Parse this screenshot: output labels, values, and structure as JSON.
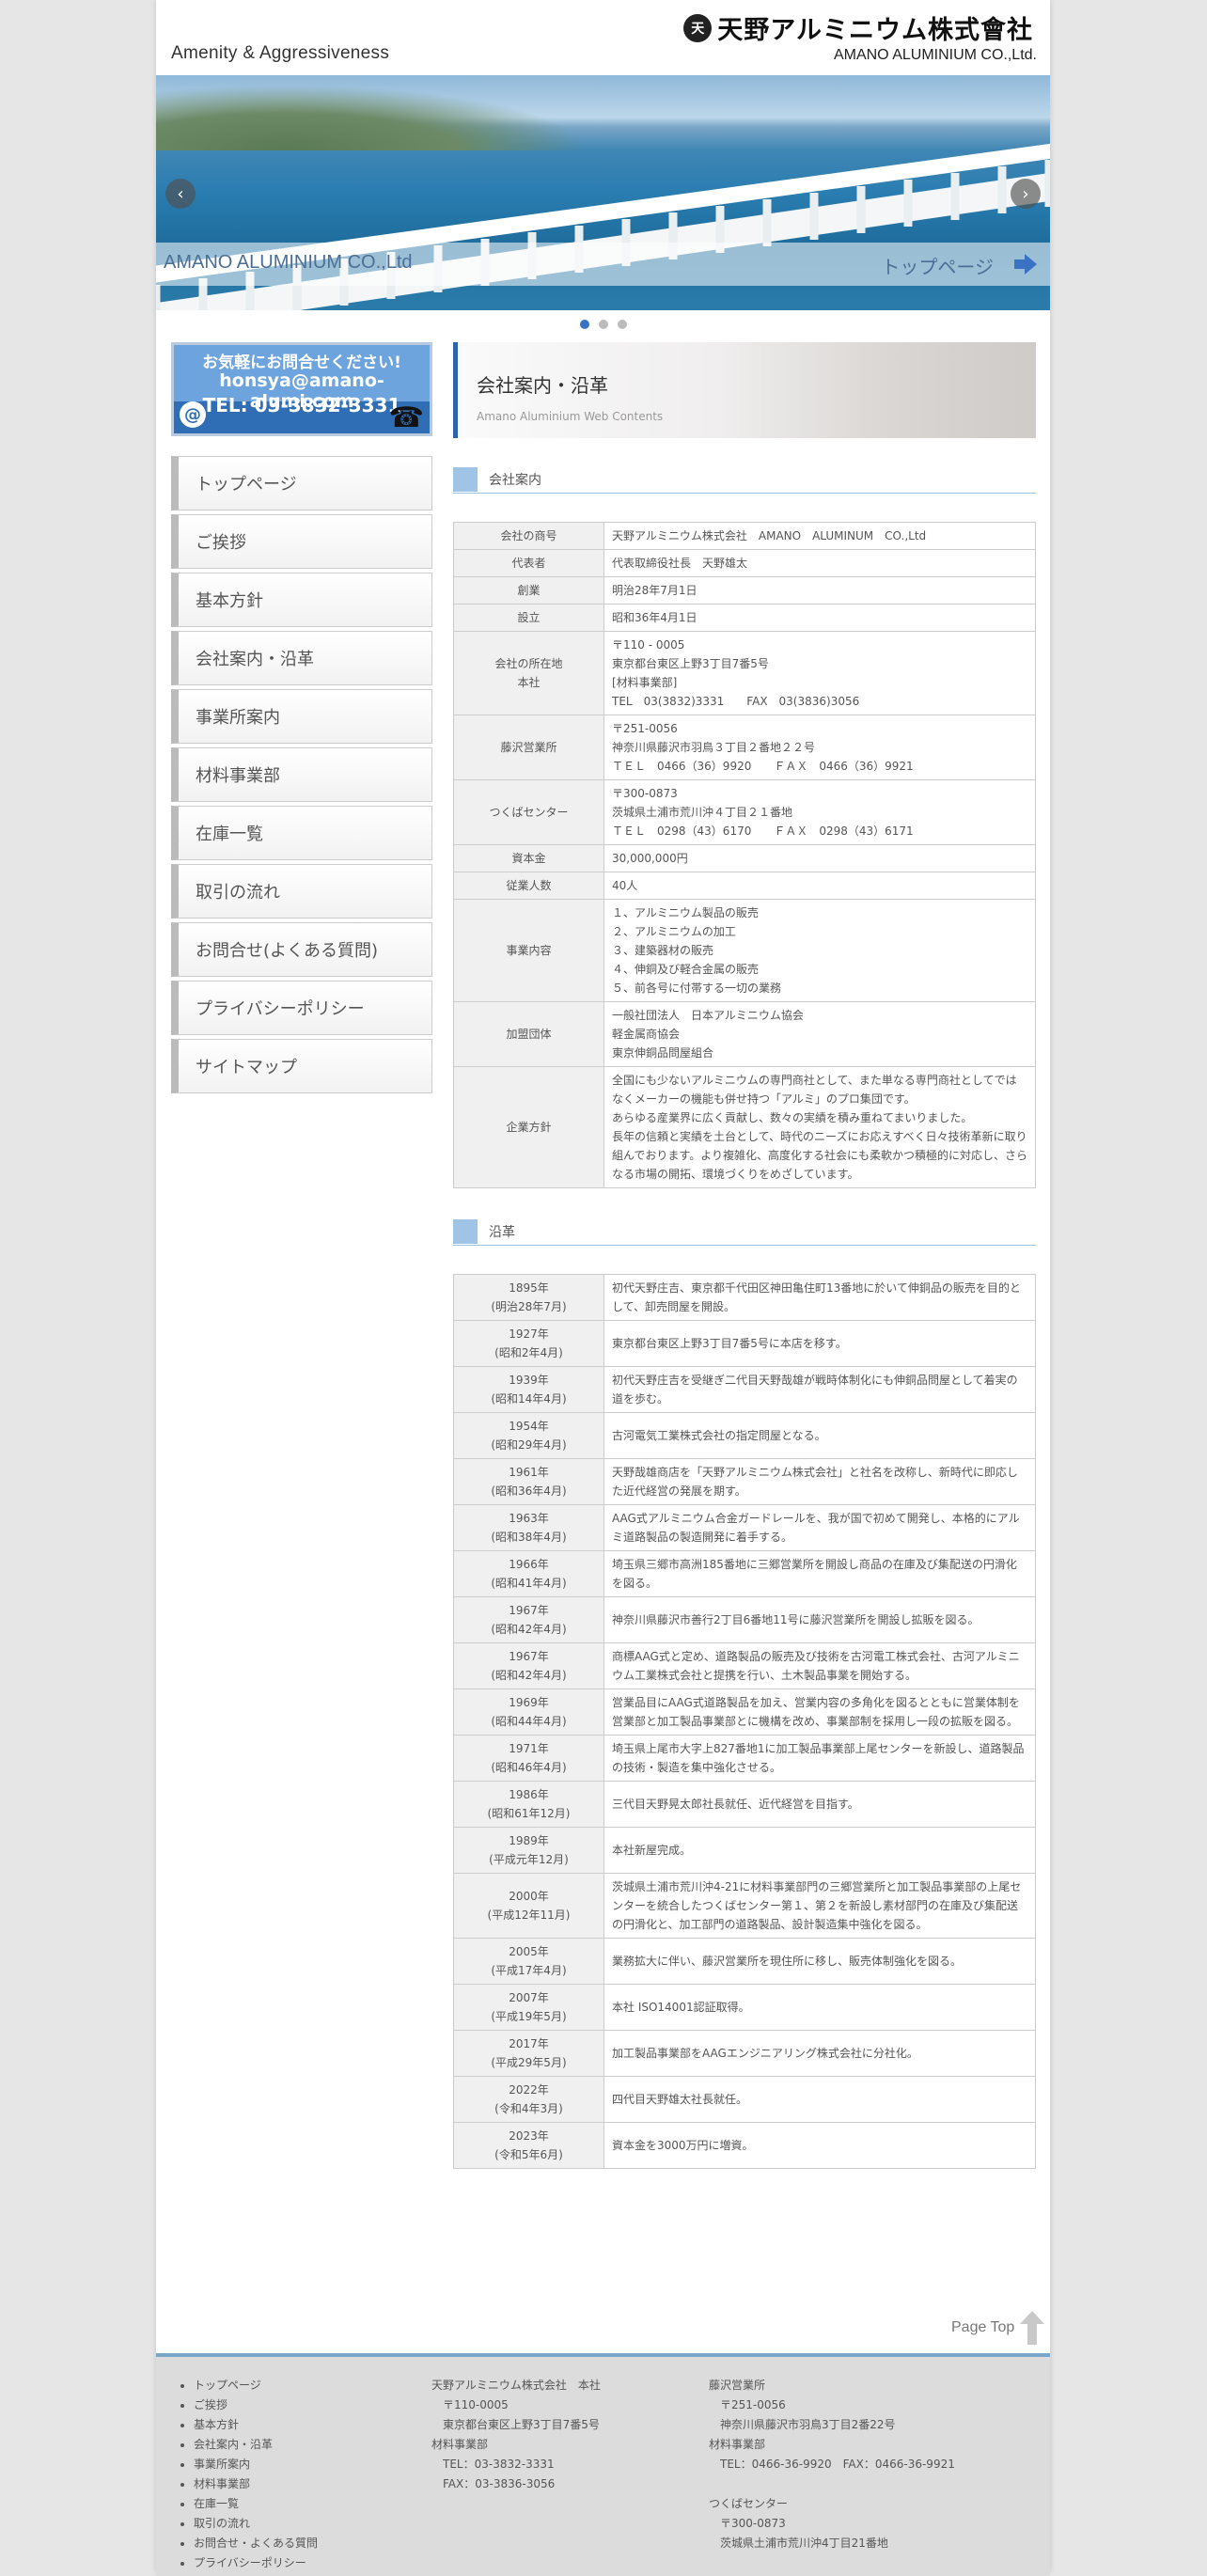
{
  "header": {
    "tagline": "Amenity & Aggressiveness",
    "logo_mark": "天",
    "logo_text": "天野アルミニウム株式會社",
    "logo_en": "AMANO ALUMINIUM CO.,Ltd."
  },
  "slider": {
    "caption_left": "AMANO ALUMINIUM CO.,Ltd",
    "caption_right": "トップページ",
    "dots": 3,
    "active_dot": 1
  },
  "contact": {
    "line1": "お気軽にお問合せください!",
    "email": "honsya@amano-alumi.com",
    "tel": "TEL: 03-3832-3331"
  },
  "nav": [
    "トップページ",
    "ご挨拶",
    "基本方針",
    "会社案内・沿革",
    "事業所案内",
    "材料事業部",
    "在庫一覧",
    "取引の流れ",
    "お問合せ(よくある質問)",
    "プライバシーポリシー",
    "サイトマップ"
  ],
  "main": {
    "title": "会社案内・沿革",
    "subtitle": "Amano Aluminium Web Contents",
    "section1": "会社案内",
    "section2": "沿革"
  },
  "company": [
    {
      "label": "会社の商号",
      "value": "天野アルミニウム株式会社　AMANO　ALUMINUM　CO.,Ltd"
    },
    {
      "label": "代表者",
      "value": "代表取締役社長　天野雄太"
    },
    {
      "label": "創業",
      "value": "明治28年7月1日"
    },
    {
      "label": "設立",
      "value": "昭和36年4月1日"
    },
    {
      "label": "会社の所在地\n本社",
      "value": "〒110 - 0005\n東京都台東区上野3丁目7番5号\n[材料事業部]\nTEL　03(3832)3331　　FAX　03(3836)3056"
    },
    {
      "label": "藤沢営業所",
      "value": "〒251-0056\n神奈川県藤沢市羽鳥３丁目２番地２２号\nＴＥＬ　0466（36）9920　　ＦＡＸ　0466（36）9921"
    },
    {
      "label": "つくばセンター",
      "value": "〒300-0873\n茨城県土浦市荒川沖４丁目２１番地\nＴＥＬ　0298（43）6170　　ＦＡＸ　0298（43）6171"
    },
    {
      "label": "資本金",
      "value": "30,000,000円"
    },
    {
      "label": "従業人数",
      "value": "40人"
    },
    {
      "label": "事業内容",
      "value": "１、アルミニウム製品の販売\n２、アルミニウムの加工\n３、建築器材の販売\n４、伸銅及び軽合金属の販売\n５、前各号に付帯する一切の業務"
    },
    {
      "label": "加盟団体",
      "value": "一般社団法人　日本アルミニウム協会\n軽金属商協会\n東京伸銅品問屋組合"
    },
    {
      "label": "企業方針",
      "value": "全国にも少ないアルミニウムの専門商社として、また単なる専門商社としてではなくメーカーの機能も併せ持つ「アルミ」のプロ集団です。\nあらゆる産業界に広く貢献し、数々の実績を積み重ねてまいりました。\n長年の信頼と実績を土台として、時代のニーズにお応えすべく日々技術革新に取り組んでおります。より複雑化、高度化する社会にも柔軟かつ積極的に対応し、さらなる市場の開拓、環境づくりをめざしています。"
    }
  ],
  "history": [
    {
      "year": "1895年\n(明治28年7月)",
      "event": "初代天野庄吉、東京都千代田区神田亀住町13番地に於いて伸銅品の販売を目的として、卸売問屋を開設。"
    },
    {
      "year": "1927年\n(昭和2年4月)",
      "event": "東京都台東区上野3丁目7番5号に本店を移す。"
    },
    {
      "year": "1939年\n(昭和14年4月)",
      "event": "初代天野庄吉を受継ぎ二代目天野哉雄が戦時体制化にも伸銅品問屋として着実の道を歩む。"
    },
    {
      "year": "1954年\n(昭和29年4月)",
      "event": "古河電気工業株式会社の指定問屋となる。"
    },
    {
      "year": "1961年\n(昭和36年4月)",
      "event": "天野哉雄商店を「天野アルミニウム株式会社」と社名を改称し、新時代に即応した近代経営の発展を期す。"
    },
    {
      "year": "1963年\n(昭和38年4月)",
      "event": "AAG式アルミニウム合金ガードレールを、我が国で初めて開発し、本格的にアルミ道路製品の製造開発に着手する。"
    },
    {
      "year": "1966年\n(昭和41年4月)",
      "event": "埼玉県三郷市高洲185番地に三郷営業所を開設し商品の在庫及び集配送の円滑化を図る。"
    },
    {
      "year": "1967年\n(昭和42年4月)",
      "event": "神奈川県藤沢市善行2丁目6番地11号に藤沢営業所を開設し拡販を図る。"
    },
    {
      "year": "1967年\n(昭和42年4月)",
      "event": "商標AAG式と定め、道路製品の販売及び技術を古河電工株式会社、古河アルミニウム工業株式会社と提携を行い、土木製品事業を開始する。"
    },
    {
      "year": "1969年\n(昭和44年4月)",
      "event": "営業品目にAAG式道路製品を加え、営業内容の多角化を図るとともに営業体制を営業部と加工製品事業部とに機構を改め、事業部制を採用し一段の拡販を図る。"
    },
    {
      "year": "1971年\n(昭和46年4月)",
      "event": "埼玉県上尾市大字上827番地1に加工製品事業部上尾センターを新設し、道路製品の技術・製造を集中強化させる。"
    },
    {
      "year": "1986年\n(昭和61年12月)",
      "event": "三代目天野晃太郎社長就任、近代経営を目指す。"
    },
    {
      "year": "1989年\n(平成元年12月)",
      "event": "本社新屋完成。"
    },
    {
      "year": "2000年\n(平成12年11月)",
      "event": "茨城県土浦市荒川沖4-21に材料事業部門の三郷営業所と加工製品事業部の上尾センターを統合したつくばセンター第１、第２を新設し素材部門の在庫及び集配送の円滑化と、加工部門の道路製品、設計製造集中強化を図る。"
    },
    {
      "year": "2005年\n(平成17年4月)",
      "event": "業務拡大に伴い、藤沢営業所を現住所に移し、販売体制強化を図る。"
    },
    {
      "year": "2007年\n(平成19年5月)",
      "event": "本社 ISO14001認証取得。"
    },
    {
      "year": "2017年\n(平成29年5月)",
      "event": "加工製品事業部をAAGエンジニアリング株式会社に分社化。"
    },
    {
      "year": "2022年\n(令和4年3月)",
      "event": "四代目天野雄太社長就任。"
    },
    {
      "year": "2023年\n(令和5年6月)",
      "event": "資本金を3000万円に増資。"
    }
  ],
  "pagetop": "Page Top",
  "footer": {
    "links": [
      "トップページ",
      "ご挨拶",
      "基本方針",
      "会社案内・沿革",
      "事業所案内",
      "材料事業部",
      "在庫一覧",
      "取引の流れ",
      "お問合せ・よくある質問",
      "プライバシーポリシー"
    ],
    "col2": "天野アルミニウム株式会社　本社\n　〒110-0005\n　東京都台東区上野3丁目7番5号\n材料事業部\n　TEL：03-3832-3331\n　FAX：03-3836-3056",
    "col3": "藤沢営業所\n　〒251-0056\n　神奈川県藤沢市羽鳥3丁目2番22号\n材料事業部\n　TEL：0466-36-9920　FAX：0466-36-9921\n\nつくばセンター\n　〒300-0873\n　茨城県土浦市荒川沖4丁目21番地"
  },
  "colors": {
    "accent": "#2f63a8",
    "section_square": "#9fc4e6",
    "footer_bg": "#dcdcdc"
  }
}
